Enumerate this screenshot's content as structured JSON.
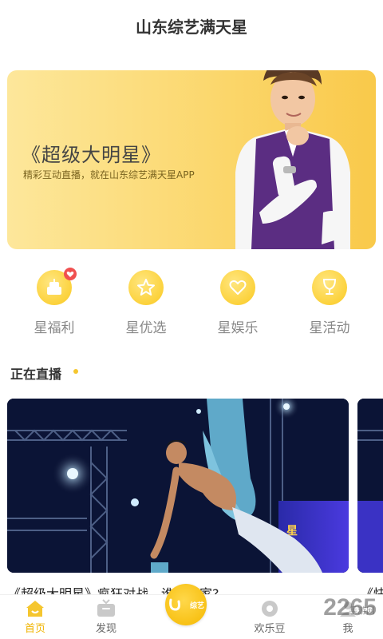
{
  "header": {
    "title": "山东综艺满天星"
  },
  "banner": {
    "title": "《超级大明星》",
    "subtitle": "精彩互动直播，就在山东综艺满天星APP"
  },
  "features": [
    {
      "label": "星福利",
      "icon": "gift-cake-icon",
      "badge": "heart"
    },
    {
      "label": "星优选",
      "icon": "star-icon"
    },
    {
      "label": "星娱乐",
      "icon": "heart-icon"
    },
    {
      "label": "星活动",
      "icon": "trophy-cup-icon"
    }
  ],
  "live": {
    "section_title": "正在直播",
    "cards": [
      {
        "caption": "《超级大明星》疯狂对战，谁是赢家?"
      },
      {
        "caption": "《快"
      }
    ]
  },
  "tabbar": {
    "items": [
      {
        "label": "首页",
        "icon": "home-icon",
        "active": true
      },
      {
        "label": "发现",
        "icon": "tv-icon"
      },
      {
        "label": "综艺",
        "icon": "center-logo-icon"
      },
      {
        "label": "欢乐豆",
        "icon": "bean-icon"
      },
      {
        "label": "我",
        "icon": "profile-icon"
      }
    ]
  },
  "watermark": {
    "text": "2265",
    "sub": "手游网"
  },
  "colors": {
    "accent": "#f5c62f",
    "banner_start": "#fde79b",
    "banner_end": "#f9c94a"
  }
}
